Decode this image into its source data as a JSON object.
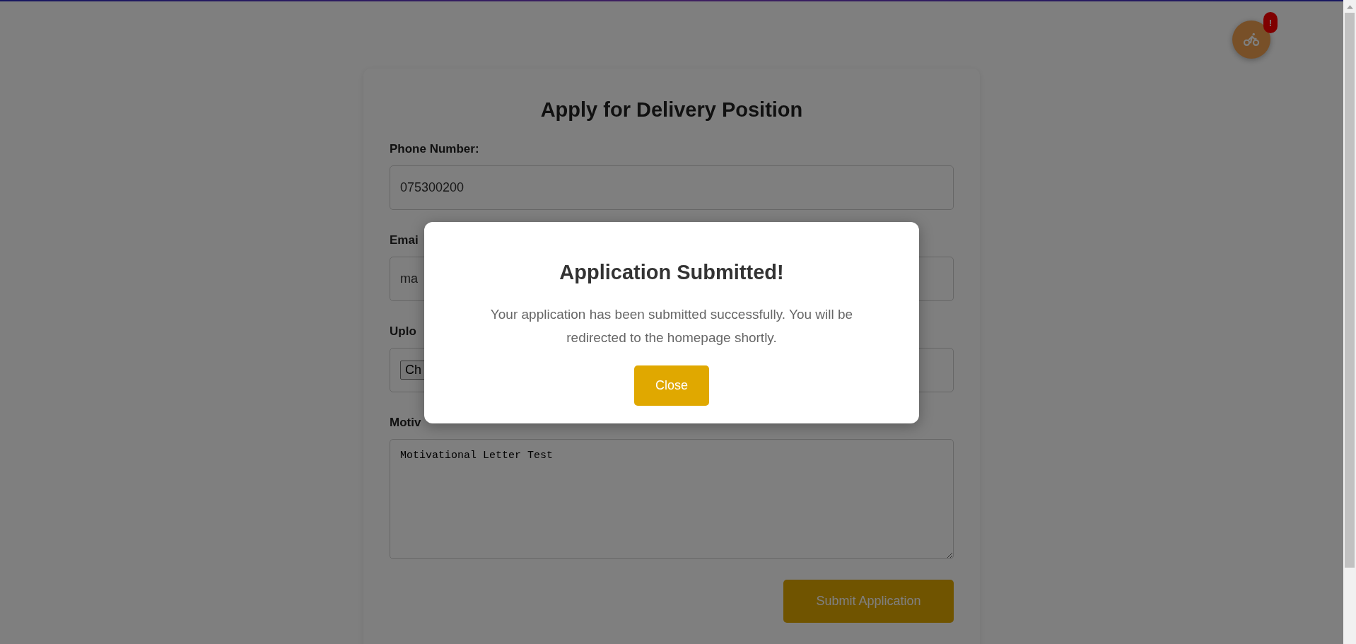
{
  "form": {
    "title": "Apply for Delivery Position",
    "fields": [
      {
        "kind": "text",
        "label": "Phone Number:",
        "value": "075300200"
      },
      {
        "kind": "text",
        "label": "Emai",
        "value": "ma"
      },
      {
        "kind": "file",
        "label": "Uplo",
        "value": "Ch"
      },
      {
        "kind": "textarea",
        "label": "Motiv",
        "value": "Motivational Letter Test"
      }
    ],
    "submit": "Submit Application"
  },
  "floating_button": {
    "badge": "!"
  },
  "modal": {
    "title": "Application Submitted!",
    "message": "Your application has been submitted successfully. You will be redirected to the homepage shortly.",
    "button": "Close"
  }
}
